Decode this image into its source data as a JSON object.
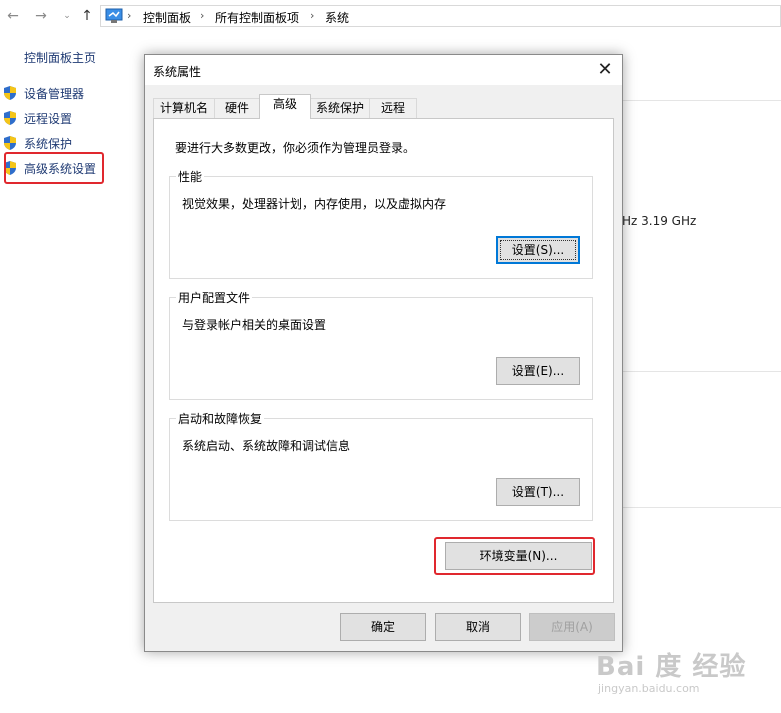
{
  "breadcrumb": {
    "items": [
      "控制面板",
      "所有控制面板项",
      "系统"
    ]
  },
  "sidebar": {
    "title": "控制面板主页",
    "items": [
      {
        "label": "设备管理器"
      },
      {
        "label": "远程设置"
      },
      {
        "label": "系统保护"
      },
      {
        "label": "高级系统设置"
      }
    ]
  },
  "background": {
    "processor_freq_partial": "Hz  3.19 GHz"
  },
  "dialog": {
    "title": "系统属性",
    "close_glyph": "✕",
    "tabs": [
      {
        "label": "计算机名"
      },
      {
        "label": "硬件"
      },
      {
        "label": "高级"
      },
      {
        "label": "系统保护"
      },
      {
        "label": "远程"
      }
    ],
    "active_tab": "高级",
    "admin_note": "要进行大多数更改，你必须作为管理员登录。",
    "performance": {
      "title": "性能",
      "desc": "视觉效果，处理器计划，内存使用，以及虚拟内存",
      "button": "设置(S)..."
    },
    "profiles": {
      "title": "用户配置文件",
      "desc": "与登录帐户相关的桌面设置",
      "button": "设置(E)..."
    },
    "startup": {
      "title": "启动和故障恢复",
      "desc": "系统启动、系统故障和调试信息",
      "button": "设置(T)..."
    },
    "env_button": "环境变量(N)...",
    "ok_button": "确定",
    "cancel_button": "取消",
    "apply_button": "应用(A)"
  },
  "watermark": {
    "brand": "Bai 度 经验",
    "url": "jingyan.baidu.com"
  },
  "colors": {
    "highlight": "#e0282e",
    "link": "#1f3a73",
    "focus_border": "#0078d7"
  }
}
